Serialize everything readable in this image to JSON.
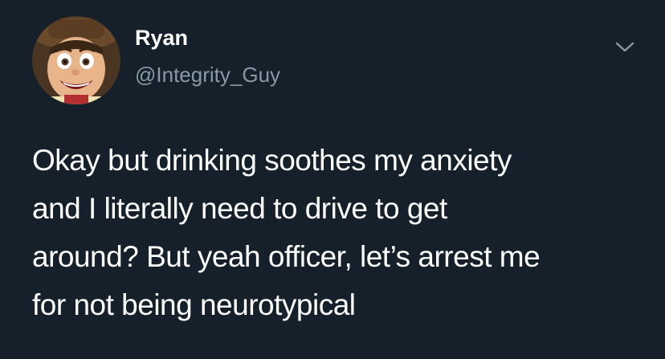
{
  "user": {
    "display_name": "Ryan",
    "handle": "@Integrity_Guy",
    "avatar_icon": "cartoon-cowboy-avatar"
  },
  "menu": {
    "icon": "chevron-down-icon"
  },
  "tweet": {
    "lines": [
      "Okay but drinking soothes my anxiety",
      "and I literally need to drive to get",
      "around? But yeah officer, let’s arrest me",
      "for not being neurotypical"
    ]
  },
  "colors": {
    "background": "#15202b",
    "text": "#ffffff",
    "secondary": "#8899a6"
  }
}
